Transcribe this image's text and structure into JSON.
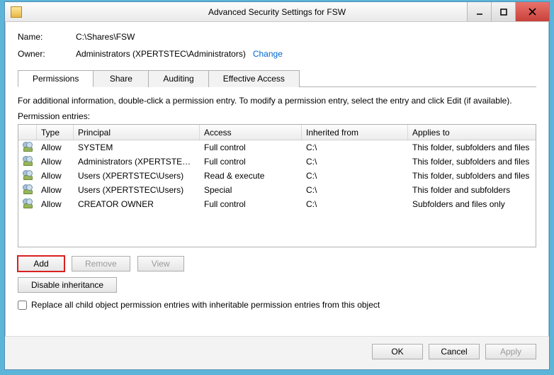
{
  "window": {
    "title": "Advanced Security Settings for FSW"
  },
  "meta": {
    "name_label": "Name:",
    "name_value": "C:\\Shares\\FSW",
    "owner_label": "Owner:",
    "owner_value": "Administrators (XPERTSTEC\\Administrators)",
    "change_link": "Change"
  },
  "tabs": {
    "permissions": "Permissions",
    "share": "Share",
    "auditing": "Auditing",
    "effective": "Effective Access"
  },
  "info_text": "For additional information, double-click a permission entry. To modify a permission entry, select the entry and click Edit (if available).",
  "list_label": "Permission entries:",
  "columns": {
    "type": "Type",
    "principal": "Principal",
    "access": "Access",
    "inherited": "Inherited from",
    "applies": "Applies to"
  },
  "rows": [
    {
      "type": "Allow",
      "principal": "SYSTEM",
      "access": "Full control",
      "inherited": "C:\\",
      "applies": "This folder, subfolders and files"
    },
    {
      "type": "Allow",
      "principal": "Administrators (XPERTSTEC\\...",
      "access": "Full control",
      "inherited": "C:\\",
      "applies": "This folder, subfolders and files"
    },
    {
      "type": "Allow",
      "principal": "Users (XPERTSTEC\\Users)",
      "access": "Read & execute",
      "inherited": "C:\\",
      "applies": "This folder, subfolders and files"
    },
    {
      "type": "Allow",
      "principal": "Users (XPERTSTEC\\Users)",
      "access": "Special",
      "inherited": "C:\\",
      "applies": "This folder and subfolders"
    },
    {
      "type": "Allow",
      "principal": "CREATOR OWNER",
      "access": "Full control",
      "inherited": "C:\\",
      "applies": "Subfolders and files only"
    }
  ],
  "buttons": {
    "add": "Add",
    "remove": "Remove",
    "view": "View",
    "disable_inh": "Disable inheritance",
    "ok": "OK",
    "cancel": "Cancel",
    "apply": "Apply"
  },
  "checkbox_label": "Replace all child object permission entries with inheritable permission entries from this object"
}
